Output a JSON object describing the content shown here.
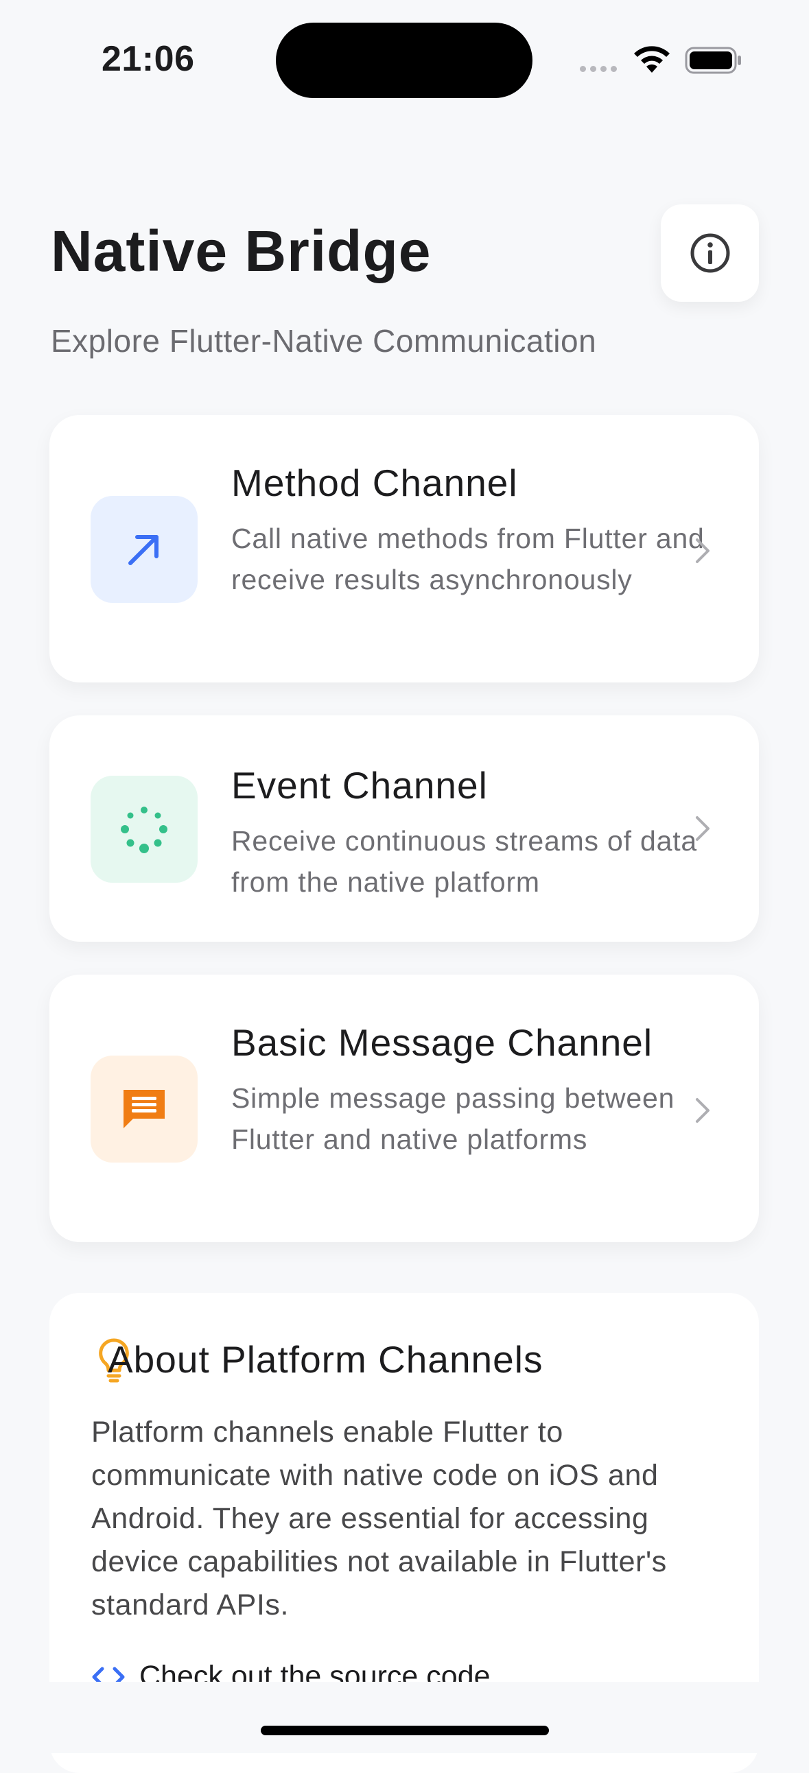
{
  "status_bar": {
    "time": "21:06"
  },
  "header": {
    "title": "Native Bridge",
    "subtitle": "Explore Flutter-Native Communication",
    "info_icon": "info-icon"
  },
  "channels": [
    {
      "title": "Method Channel",
      "description": "Call native methods from Flutter and receive results asynchronously",
      "icon": "arrow-up-right-icon",
      "icon_color": "#3b6ff5",
      "icon_bg": "#e8f0ff"
    },
    {
      "title": "Event Channel",
      "description": "Receive continuous streams of data from the native platform",
      "icon": "stream-icon",
      "icon_color": "#34c08a",
      "icon_bg": "#e6f8f0"
    },
    {
      "title": "Basic Message Channel",
      "description": "Simple message passing between Flutter and native platforms",
      "icon": "message-icon",
      "icon_color": "#f07d14",
      "icon_bg": "#fff1e3"
    }
  ],
  "about": {
    "title": "About Platform Channels",
    "icon": "lightbulb-icon",
    "icon_color": "#f5a623",
    "text": "Platform channels enable Flutter to communicate with native code on iOS and Android. They are essential for accessing device capabilities not available in Flutter's standard APIs.",
    "link_label": "Check out the source code",
    "link_icon": "code-icon",
    "link_color": "#3b6ff5"
  }
}
